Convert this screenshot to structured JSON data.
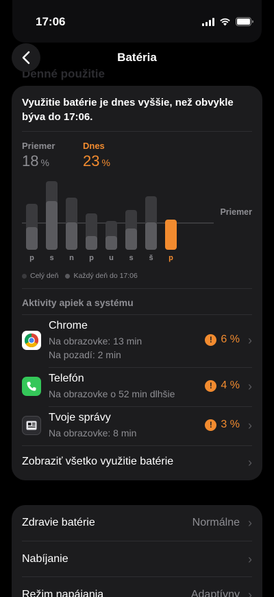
{
  "status_bar": {
    "time": "17:06"
  },
  "nav": {
    "title": "Batéria"
  },
  "background": {
    "section_title": "Denné použitie"
  },
  "summary": {
    "headline": "Využitie batérie je dnes vyššie, než obvykle býva do 17:06.",
    "average_label": "Priemer",
    "average_value": "18",
    "today_label": "Dnes",
    "today_value": "23",
    "unit": "%"
  },
  "chart_data": {
    "type": "bar",
    "categories": [
      "p",
      "s",
      "n",
      "p",
      "u",
      "s",
      "š",
      "p"
    ],
    "series": [
      {
        "name": "Celý deň",
        "values": [
          30,
          45,
          34,
          24,
          19,
          26,
          35,
          20
        ]
      },
      {
        "name": "Každý deň do 17:06",
        "values": [
          15,
          32,
          18,
          9,
          9,
          14,
          18,
          20
        ]
      }
    ],
    "average": 18,
    "average_label": "Priemer",
    "legend": [
      "Celý deň",
      "Každý deň do 17:06"
    ],
    "today_index": 7,
    "colors": {
      "full_day": "#3a3a3d",
      "until_now": "#5a5a5e",
      "today": "#f28b2f",
      "average_line": "#3a3a3d"
    }
  },
  "activities": {
    "title": "Aktivity apiek a systému",
    "apps": [
      {
        "name": "Chrome",
        "sub1": "Na obrazovke: 13 min",
        "sub2": "Na pozadí: 2 min",
        "percent": "6 %",
        "icon": "chrome-icon"
      },
      {
        "name": "Telefón",
        "sub1": "Na obrazovke o 52 min dlhšie",
        "sub2": "",
        "percent": "4 %",
        "icon": "phone-icon"
      },
      {
        "name": "Tvoje správy",
        "sub1": "Na obrazovke: 8 min",
        "sub2": "",
        "percent": "3 %",
        "icon": "news-icon"
      }
    ],
    "show_all": "Zobraziť všetko využitie batérie"
  },
  "settings": {
    "health_label": "Zdravie batérie",
    "health_value": "Normálne",
    "charging_label": "Nabíjanie",
    "power_mode_label": "Režim napájania",
    "power_mode_value": "Adaptívny"
  },
  "colors": {
    "accent": "#f28b2f",
    "card": "#1c1c1e",
    "secondary_text": "#8e8e93"
  }
}
